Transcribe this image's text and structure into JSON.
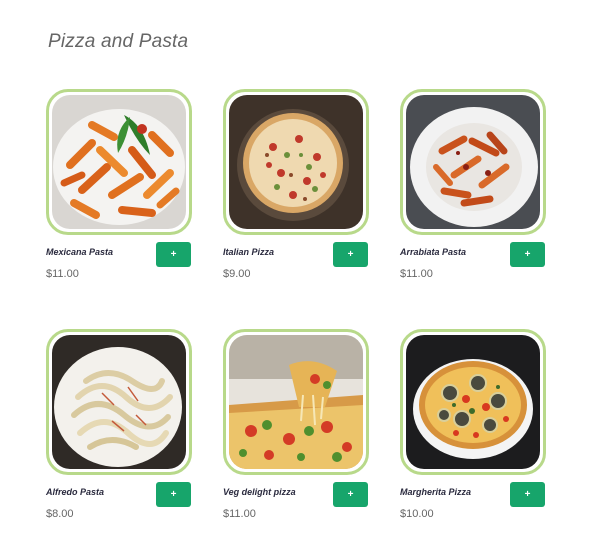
{
  "section": {
    "title": "Pizza and Pasta"
  },
  "products": [
    {
      "name": "Mexicana Pasta",
      "price": "$11.00",
      "add_label": "+"
    },
    {
      "name": "Italian Pizza",
      "price": "$9.00",
      "add_label": "+"
    },
    {
      "name": "Arrabiata Pasta",
      "price": "$11.00",
      "add_label": "+"
    },
    {
      "name": "Alfredo Pasta",
      "price": "$8.00",
      "add_label": "+"
    },
    {
      "name": "Veg delight pizza",
      "price": "$11.00",
      "add_label": "+"
    },
    {
      "name": "Margherita Pizza",
      "price": "$10.00",
      "add_label": "+"
    }
  ],
  "colors": {
    "card_border": "#b8d98a",
    "add_button": "#17a56b",
    "price_text": "#666666",
    "name_text": "#2a2a3e"
  }
}
